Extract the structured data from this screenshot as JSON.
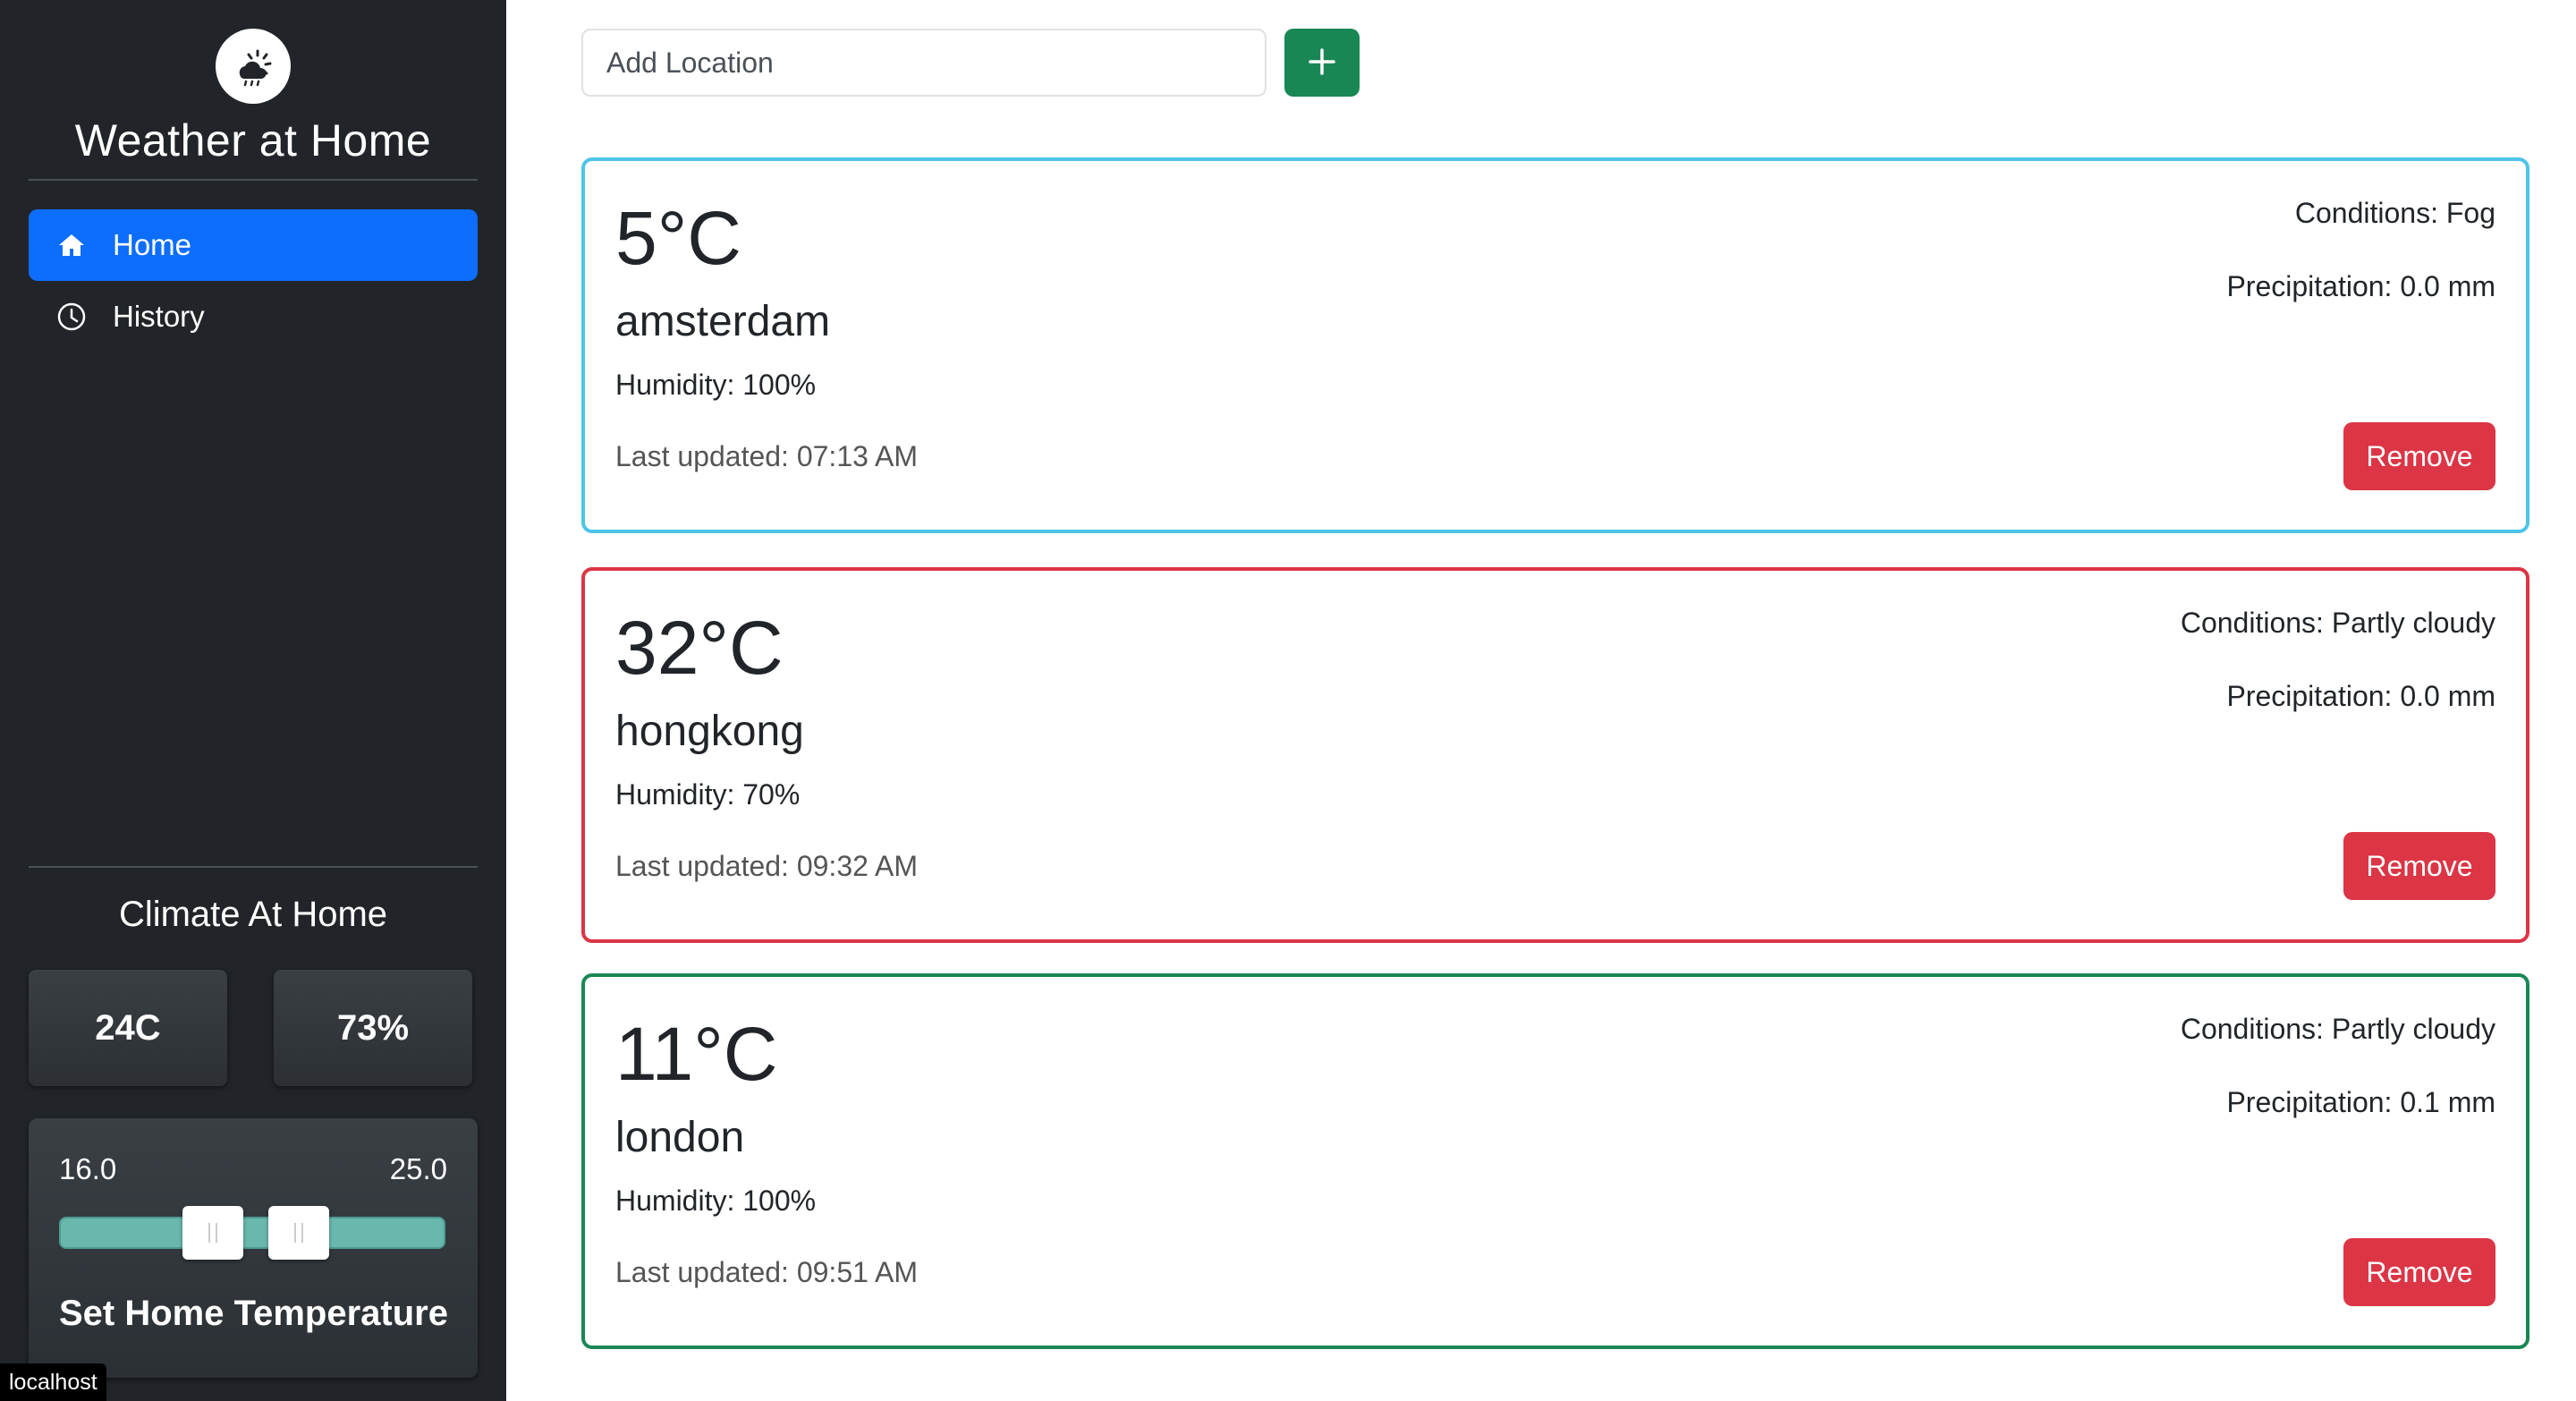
{
  "sidebar": {
    "brand_title": "Weather at Home",
    "logo_icon": "partly-cloudy-icon",
    "nav": [
      {
        "label": "Home",
        "icon": "home-icon",
        "active": true
      },
      {
        "label": "History",
        "icon": "clock-icon",
        "active": false
      }
    ],
    "climate": {
      "title": "Climate At Home",
      "temperature": "24C",
      "humidity": "73%"
    },
    "temperature_range": {
      "min": "16.0",
      "max": "25.0",
      "label": "Set Home Temperature"
    }
  },
  "status_tip": "localhost",
  "add_location": {
    "placeholder": "Add Location",
    "button_icon": "plus-icon"
  },
  "cards": [
    {
      "temperature": "5°C",
      "city": "amsterdam",
      "humidity": "Humidity: 100%",
      "updated": "Last updated: 07:13 AM",
      "conditions": "Conditions: Fog",
      "precipitation": "Precipitation: 0.0 mm",
      "remove_label": "Remove",
      "border_color": "#4fc3e8"
    },
    {
      "temperature": "32°C",
      "city": "hongkong",
      "humidity": "Humidity: 70%",
      "updated": "Last updated: 09:32 AM",
      "conditions": "Conditions: Partly cloudy",
      "precipitation": "Precipitation: 0.0 mm",
      "remove_label": "Remove",
      "border_color": "#dc3545"
    },
    {
      "temperature": "11°C",
      "city": "london",
      "humidity": "Humidity: 100%",
      "updated": "Last updated: 09:51 AM",
      "conditions": "Conditions: Partly cloudy",
      "precipitation": "Precipitation: 0.1 mm",
      "remove_label": "Remove",
      "border_color": "#198754"
    }
  ],
  "colors": {
    "sidebar_bg": "#212529",
    "active_nav": "#0d6efd",
    "add_button": "#198754",
    "remove_button": "#dc3545",
    "slider": "#6ab8ad"
  }
}
